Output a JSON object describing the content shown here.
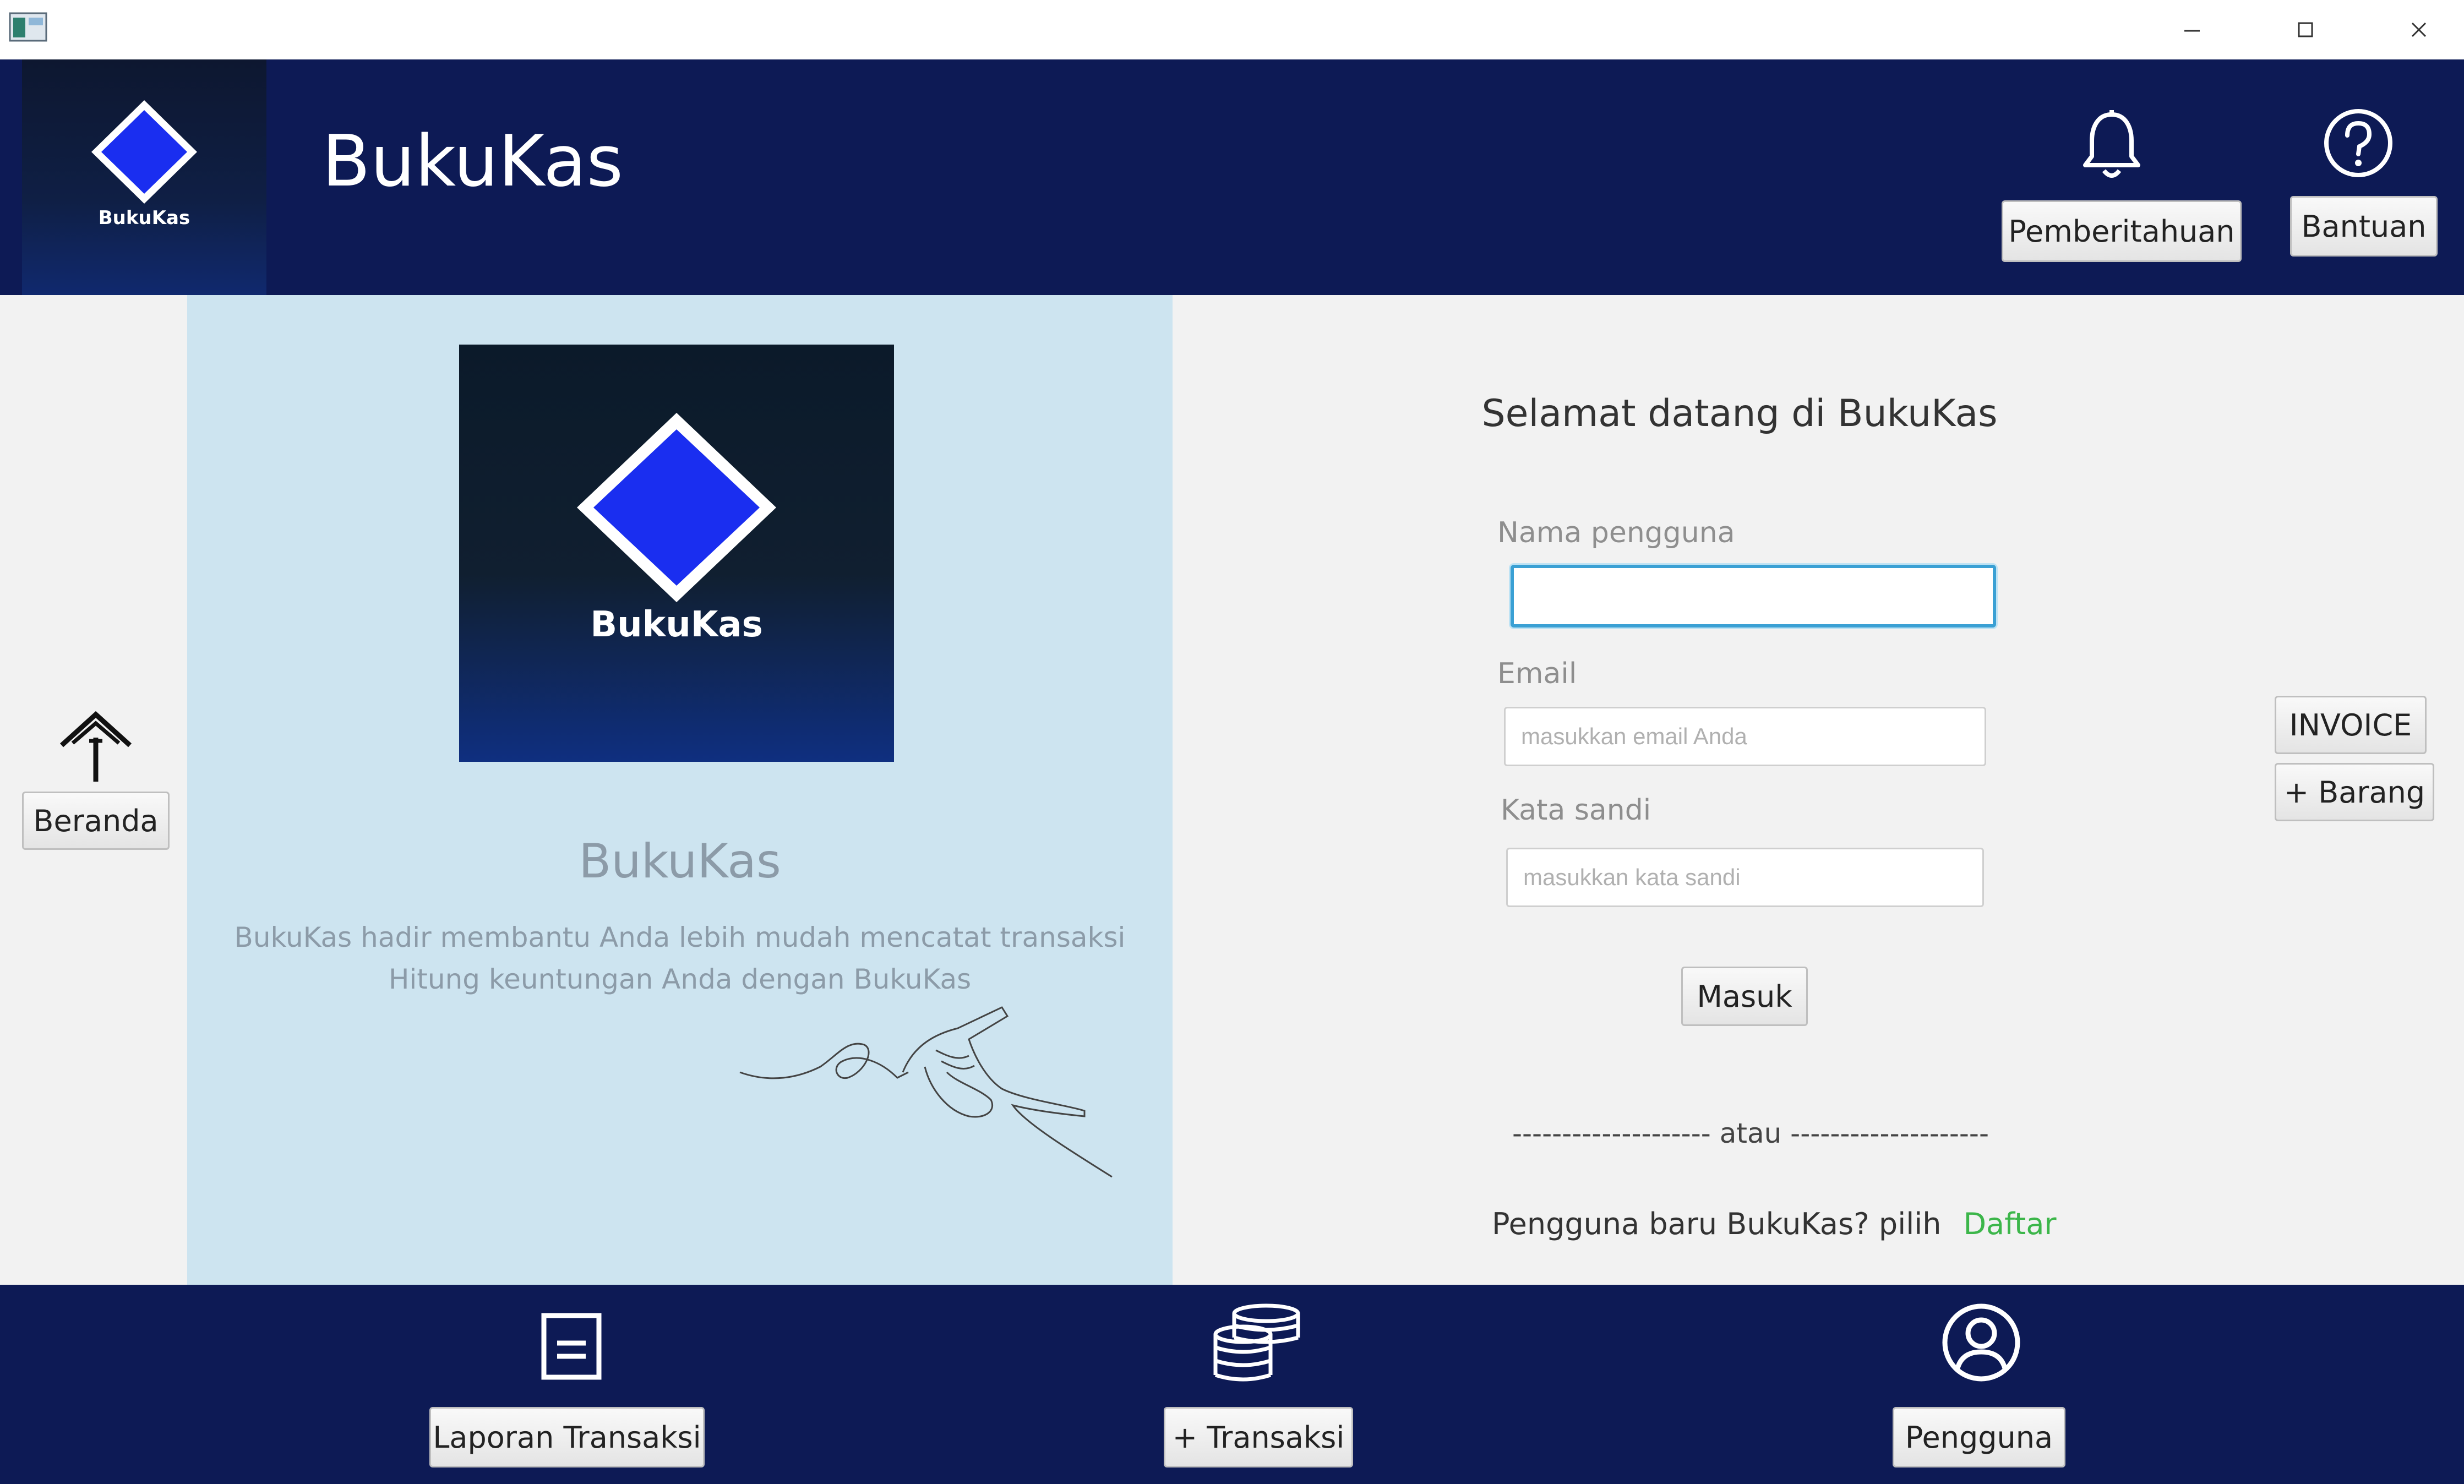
{
  "window": {
    "minimize_icon": "minimize-icon",
    "maximize_icon": "maximize-icon",
    "close_icon": "close-icon"
  },
  "header": {
    "logo_text": "BukuKas",
    "title": "BukuKas",
    "notifications_label": "Pemberitahuan",
    "help_label": "Bantuan",
    "bell_icon": "bell-icon",
    "help_icon": "question-circle-icon"
  },
  "sidebar": {
    "home_label": "Beranda",
    "home_icon": "home-icon",
    "invoice_label": "INVOICE",
    "add_item_label": "+ Barang"
  },
  "promo": {
    "logo_text": "BukuKas",
    "title": "BukuKas",
    "line1": "BukuKas hadir membantu Anda lebih mudah mencatat transaksi",
    "line2": "Hitung keuntungan Anda dengan BukuKas"
  },
  "login": {
    "welcome": "Selamat datang di BukuKas",
    "username_label": "Nama pengguna",
    "username_value": "",
    "email_label": "Email",
    "email_placeholder": "masukkan email Anda",
    "password_label": "Kata sandi",
    "password_placeholder": "masukkan kata sandi",
    "submit_label": "Masuk",
    "separator": "-------------------- atau --------------------",
    "register_prompt": "Pengguna baru BukuKas?  pilih",
    "register_link": "Daftar"
  },
  "footer": {
    "report_label": "Laporan Transaksi",
    "add_transaction_label": "+ Transaksi",
    "user_label": "Pengguna",
    "report_icon": "document-icon",
    "coins_icon": "coins-icon",
    "user_icon": "user-circle-icon"
  },
  "colors": {
    "header_bg": "#0d1a55",
    "promo_bg": "#cde4f0",
    "logo_diamond": "#1a2ef0",
    "link_green": "#3cb64a",
    "focus_blue": "#3aa0d4"
  }
}
